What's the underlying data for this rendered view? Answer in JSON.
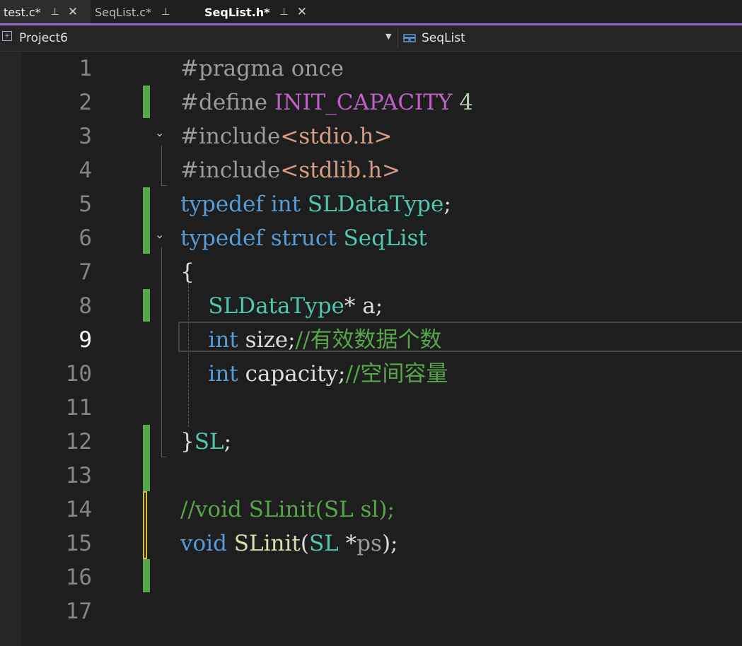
{
  "tabs": [
    {
      "label": "test.c*",
      "pinned": true,
      "active": false
    },
    {
      "label": "SeqList.c*",
      "pinned": true,
      "active": false
    },
    {
      "label": "SeqList.h*",
      "pinned": true,
      "active": true
    }
  ],
  "tab_icons": {
    "pin": "pin-icon",
    "close": "close-icon"
  },
  "tab_glyphs": {
    "pin": "⊥",
    "close": "✕"
  },
  "navbar": {
    "project": "Project6",
    "scope": "SeqList",
    "dropdown_glyph": "▼",
    "project_icon_glyph": "+"
  },
  "editor": {
    "current_line": 9,
    "line_numbers": [
      "1",
      "2",
      "3",
      "4",
      "5",
      "6",
      "7",
      "8",
      "9",
      "10",
      "11",
      "12",
      "13",
      "14",
      "15",
      "16",
      "17"
    ],
    "lines": {
      "l1": {
        "a": "#pragma once"
      },
      "l2": {
        "a": "#define ",
        "b": "INIT_CAPACITY",
        "c": " ",
        "d": "4"
      },
      "l3": {
        "a": "#include",
        "b": "<stdio.h>"
      },
      "l4": {
        "a": "#include",
        "b": "<stdlib.h>"
      },
      "l5": {
        "a": "typedef",
        "b": " ",
        "c": "int",
        "d": " ",
        "e": "SLDataType",
        "f": ";"
      },
      "l6": {
        "a": "typedef",
        "b": " ",
        "c": "struct",
        "d": " ",
        "e": "SeqList"
      },
      "l7": {
        "a": "{"
      },
      "l8": {
        "a": "    ",
        "b": "SLDataType",
        "c": "* a;"
      },
      "l9": {
        "a": "    ",
        "b": "int",
        "c": " size;",
        "d": "//有效数据个数"
      },
      "l10": {
        "a": "    ",
        "b": "int",
        "c": " capacity;",
        "d": "//空间容量"
      },
      "l12": {
        "a": "}",
        "b": "SL",
        "c": ";"
      },
      "l14": {
        "a": "//void SLinit(SL sl);"
      },
      "l15": {
        "a": "void",
        "b": " ",
        "c": "SLinit",
        "d": "(",
        "e": "SL",
        "f": " *",
        "g": "ps",
        "h": ");"
      }
    },
    "fold_glyph": "⌄"
  }
}
